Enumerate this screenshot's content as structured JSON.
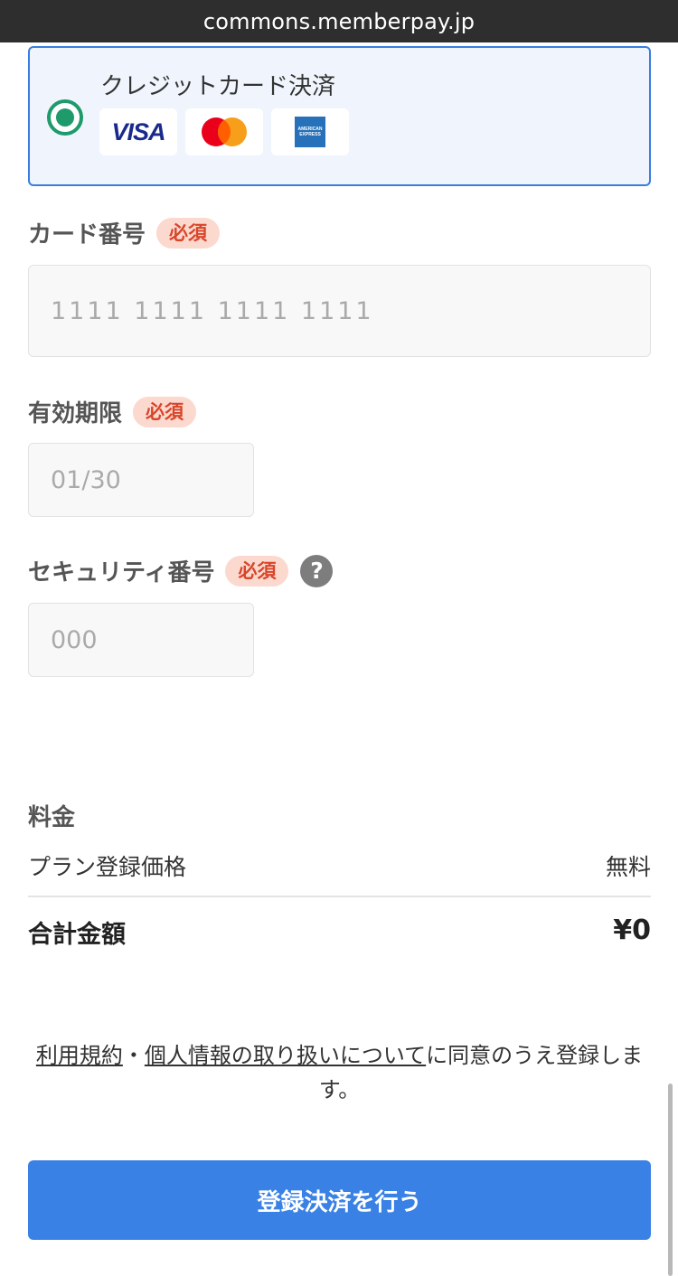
{
  "browser": {
    "url": "commons.memberpay.jp"
  },
  "payment": {
    "option_label": "クレジットカード決済",
    "brands": [
      "VISA",
      "mastercard-icon",
      "amex-icon"
    ],
    "visa_text": "VISA",
    "amex_text": "AMERICAN EXPRESS"
  },
  "badges": {
    "required": "必須"
  },
  "fields": {
    "card_number": {
      "label": "カード番号",
      "placeholder": "1111 1111 1111 1111",
      "value": ""
    },
    "expiry": {
      "label": "有効期限",
      "placeholder": "01/30",
      "value": ""
    },
    "security_code": {
      "label": "セキュリティ番号",
      "placeholder": "000",
      "value": "",
      "help": "?"
    }
  },
  "pricing": {
    "title": "料金",
    "plan_label": "プラン登録価格",
    "plan_value": "無料",
    "total_label": "合計金額",
    "total_value": "¥0"
  },
  "consent": {
    "terms_link": "利用規約",
    "separator": "・",
    "privacy_link": "個人情報の取り扱いについて",
    "suffix": "に同意のうえ登録します。"
  },
  "submit": {
    "label": "登録決済を行う"
  },
  "colors": {
    "primary": "#3a81e6",
    "radio": "#1e9a6b",
    "required_badge_bg": "#fbd9cf",
    "required_badge_text": "#d8452a"
  }
}
